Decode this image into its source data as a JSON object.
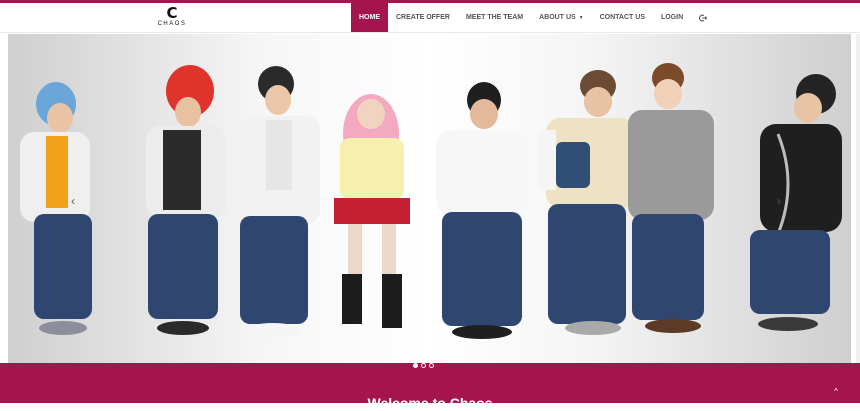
{
  "brand": {
    "mark": "C",
    "name": "CHAOS"
  },
  "nav": {
    "items": [
      {
        "label": "HOME",
        "active": true
      },
      {
        "label": "CREATE OFFER"
      },
      {
        "label": "MEET THE TEAM"
      },
      {
        "label": "ABOUT US",
        "dropdown": true
      },
      {
        "label": "CONTACT US"
      },
      {
        "label": "LOGIN"
      }
    ],
    "logout_icon": "logout-icon"
  },
  "carousel": {
    "slide_count": 3,
    "active_slide": 1,
    "prev_icon": "chevron-left-icon",
    "next_icon": "chevron-right-icon",
    "prev_glyph": "‹",
    "next_glyph": "›"
  },
  "hero": {
    "title": "Welcome to Chaos"
  },
  "scroll_top_glyph": "^",
  "colors": {
    "accent": "#a5154d",
    "nav_text": "#555555"
  }
}
